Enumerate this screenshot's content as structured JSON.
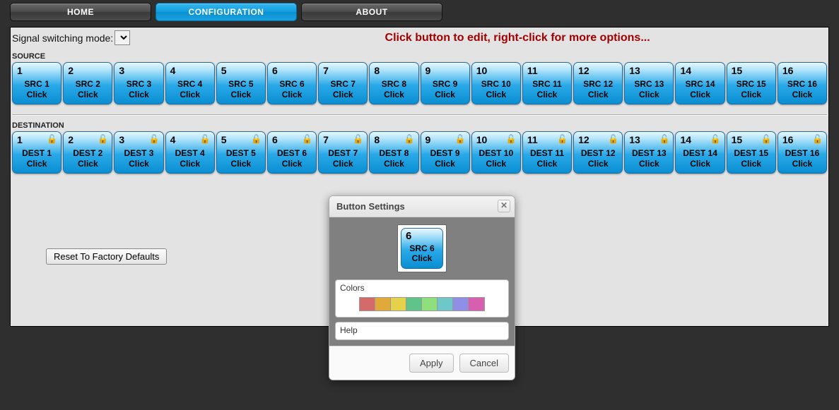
{
  "nav": {
    "home": "HOME",
    "configuration": "CONFIGURATION",
    "about": "ABOUT",
    "active": "configuration"
  },
  "mode_label": "Signal switching mode:",
  "hint": "Click button to edit, right-click for more options...",
  "section_source": "SOURCE",
  "section_destination": "DESTINATION",
  "click_label": "Click",
  "sources": [
    {
      "num": "1",
      "name": "SRC 1"
    },
    {
      "num": "2",
      "name": "SRC 2"
    },
    {
      "num": "3",
      "name": "SRC 3"
    },
    {
      "num": "4",
      "name": "SRC 4"
    },
    {
      "num": "5",
      "name": "SRC 5"
    },
    {
      "num": "6",
      "name": "SRC 6"
    },
    {
      "num": "7",
      "name": "SRC 7"
    },
    {
      "num": "8",
      "name": "SRC 8"
    },
    {
      "num": "9",
      "name": "SRC 9"
    },
    {
      "num": "10",
      "name": "SRC 10"
    },
    {
      "num": "11",
      "name": "SRC 11"
    },
    {
      "num": "12",
      "name": "SRC 12"
    },
    {
      "num": "13",
      "name": "SRC 13"
    },
    {
      "num": "14",
      "name": "SRC 14"
    },
    {
      "num": "15",
      "name": "SRC 15"
    },
    {
      "num": "16",
      "name": "SRC 16"
    }
  ],
  "destinations": [
    {
      "num": "1",
      "name": "DEST 1"
    },
    {
      "num": "2",
      "name": "DEST 2"
    },
    {
      "num": "3",
      "name": "DEST 3"
    },
    {
      "num": "4",
      "name": "DEST 4"
    },
    {
      "num": "5",
      "name": "DEST 5"
    },
    {
      "num": "6",
      "name": "DEST 6"
    },
    {
      "num": "7",
      "name": "DEST 7"
    },
    {
      "num": "8",
      "name": "DEST 8"
    },
    {
      "num": "9",
      "name": "DEST 9"
    },
    {
      "num": "10",
      "name": "DEST 10"
    },
    {
      "num": "11",
      "name": "DEST 11"
    },
    {
      "num": "12",
      "name": "DEST 12"
    },
    {
      "num": "13",
      "name": "DEST 13"
    },
    {
      "num": "14",
      "name": "DEST 14"
    },
    {
      "num": "15",
      "name": "DEST 15"
    },
    {
      "num": "16",
      "name": "DEST 16"
    }
  ],
  "reset_label": "Reset To Factory Defaults",
  "dialog": {
    "title": "Button Settings",
    "preview": {
      "num": "6",
      "name": "SRC 6",
      "click": "Click"
    },
    "colors_label": "Colors",
    "help_label": "Help",
    "apply": "Apply",
    "cancel": "Cancel",
    "swatches": [
      "#d46a6a",
      "#e1a93a",
      "#e6d24a",
      "#5fc38a",
      "#8fe07d",
      "#6fc7c9",
      "#8f8fe6",
      "#d65fb1"
    ]
  }
}
